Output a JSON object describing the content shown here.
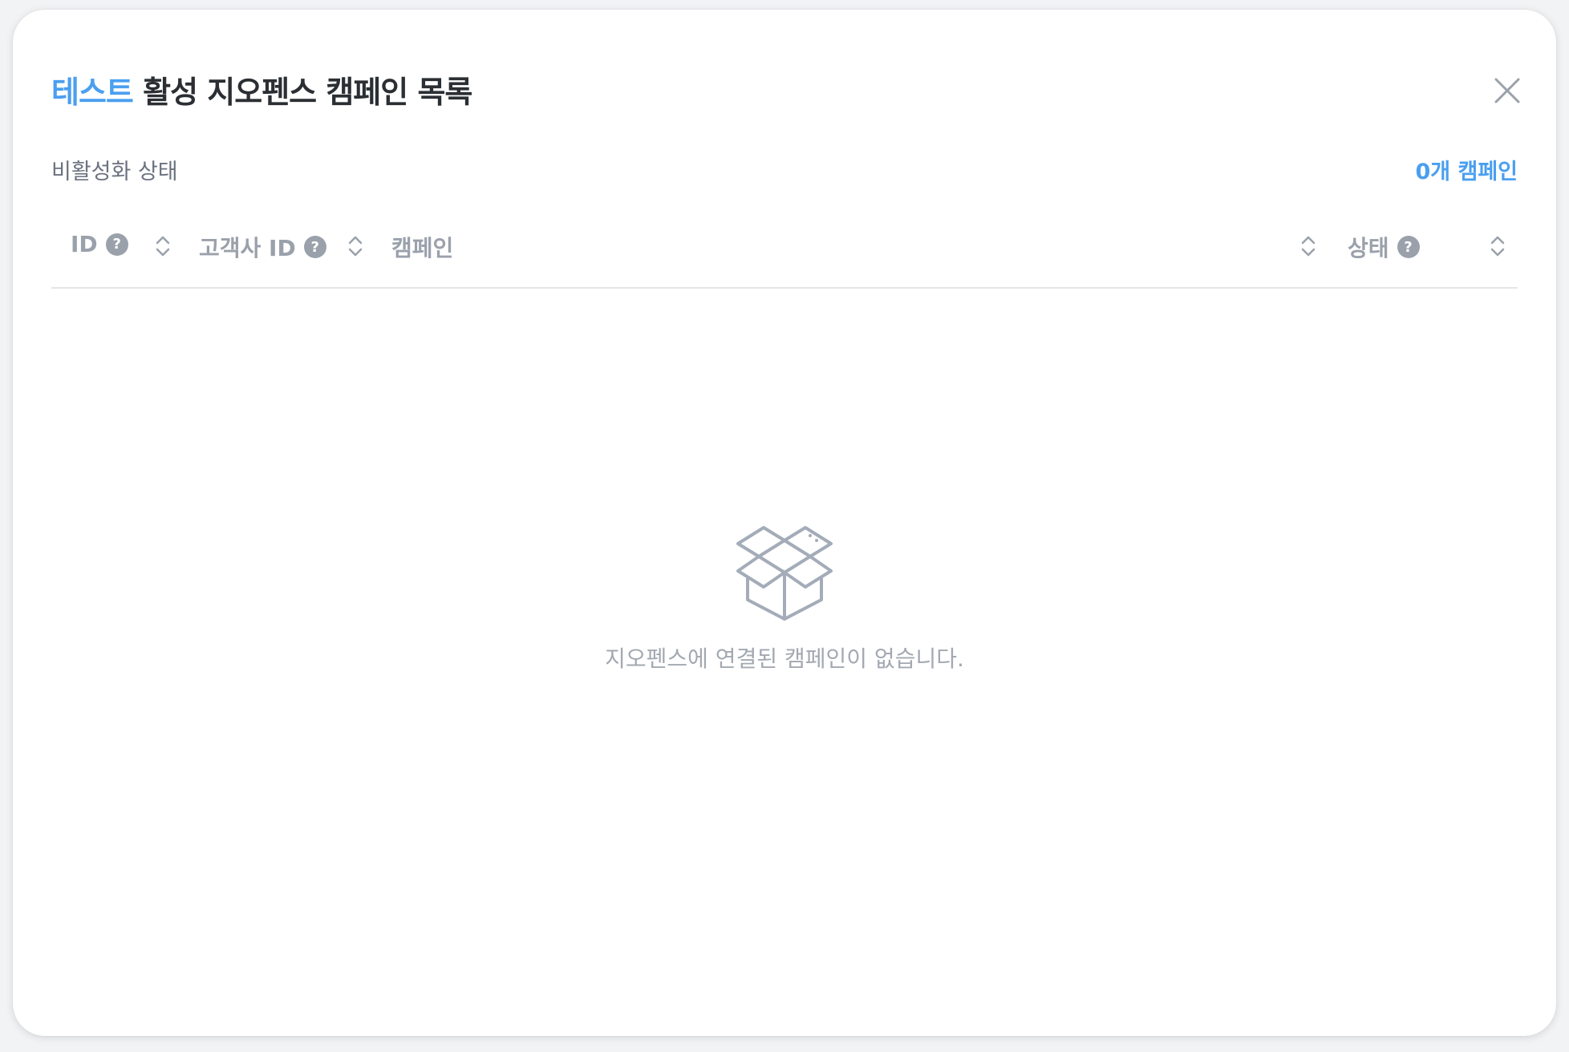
{
  "modal": {
    "title_accent": "테스트",
    "title_rest": " 활성 지오펜스  캠페인 목록",
    "subtitle": "비활성화 상태",
    "count": "0개 캠페인"
  },
  "table": {
    "columns": [
      {
        "label": "ID",
        "help": "?"
      },
      {
        "label": "고객사 ID",
        "help": "?"
      },
      {
        "label": "캠페인"
      },
      {
        "label": "상태",
        "help": "?"
      }
    ]
  },
  "empty_state": {
    "icon": "open-box-icon",
    "message": "지오펜스에 연결된 캠페인이 없습니다."
  },
  "colors": {
    "accent": "#4a9ff0",
    "header_text": "#9aa1ab",
    "title_text": "#2b2f33"
  }
}
